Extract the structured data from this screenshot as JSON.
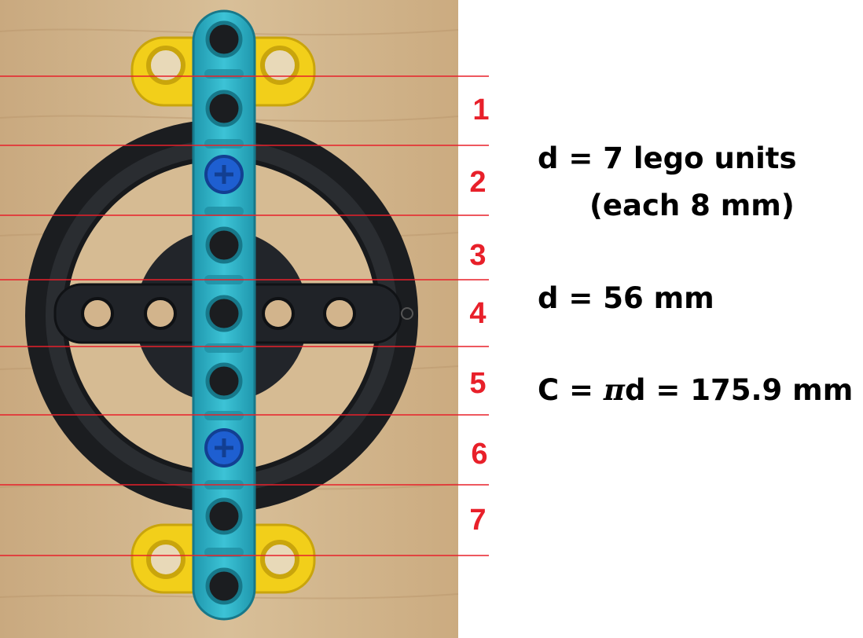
{
  "unit_labels": [
    "1",
    "2",
    "3",
    "4",
    "5",
    "6",
    "7"
  ],
  "annotations": {
    "diameter_units": "d = 7 lego units",
    "unit_size": "(each 8 mm)",
    "diameter_mm": "d = 56 mm",
    "circumference_prefix": "C = ",
    "pi_symbol": "π",
    "circumference_suffix": "d = 175.9 mm"
  },
  "colors": {
    "guide_line": "#e8202a",
    "label": "#e8202a",
    "beam": "#2ab3c9",
    "tire": "#1b1d20",
    "connector": "#f2cf1a",
    "pin": "#1e5fd1",
    "wood": "#d2b48c"
  }
}
